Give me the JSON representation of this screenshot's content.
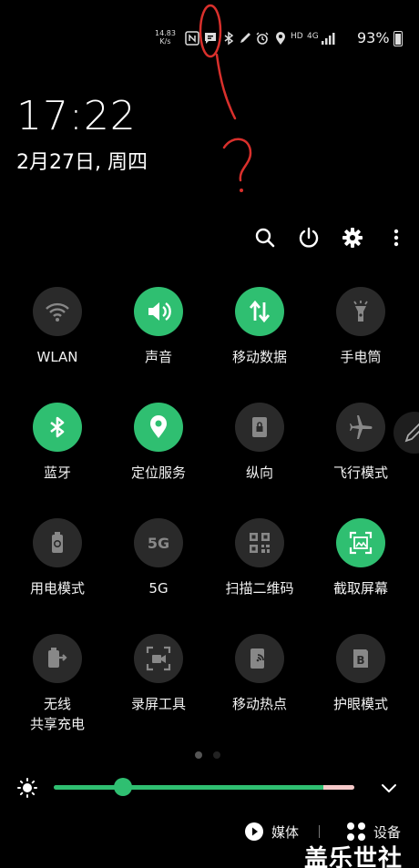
{
  "status_bar": {
    "speed_value": "14.83",
    "speed_unit": "K/s",
    "network": "HD",
    "signal": "4G",
    "battery_percent": "93%",
    "icons": [
      "nfc-icon",
      "message-icon",
      "bluetooth-icon",
      "pen-icon",
      "alarm-icon",
      "location-icon",
      "hd-icon",
      "signal-icon",
      "battery-icon"
    ]
  },
  "clock": {
    "time": "17:22",
    "date": "2月27日, 周四"
  },
  "toolbar": {
    "icons": [
      "search-icon",
      "power-icon",
      "settings-icon",
      "more-icon"
    ]
  },
  "tiles": [
    {
      "label": "WLAN",
      "icon": "wifi-icon",
      "active": false
    },
    {
      "label": "声音",
      "icon": "volume-icon",
      "active": true
    },
    {
      "label": "移动数据",
      "icon": "mobile-data-icon",
      "active": true
    },
    {
      "label": "手电筒",
      "icon": "flashlight-icon",
      "active": false
    },
    {
      "label": "蓝牙",
      "icon": "bluetooth-icon",
      "active": true
    },
    {
      "label": "定位服务",
      "icon": "location-icon",
      "active": true
    },
    {
      "label": "纵向",
      "icon": "portrait-lock-icon",
      "active": false
    },
    {
      "label": "飞行模式",
      "icon": "airplane-icon",
      "active": false
    },
    {
      "label": "用电模式",
      "icon": "power-mode-icon",
      "active": false
    },
    {
      "label": "5G",
      "icon": "5g-icon",
      "active": false
    },
    {
      "label": "扫描二维码",
      "icon": "qr-code-icon",
      "active": false
    },
    {
      "label": "截取屏幕",
      "icon": "screenshot-icon",
      "active": true
    },
    {
      "label": "无线\n共享充电",
      "icon": "wireless-share-icon",
      "active": false
    },
    {
      "label": "录屏工具",
      "icon": "screen-record-icon",
      "active": false
    },
    {
      "label": "移动热点",
      "icon": "hotspot-icon",
      "active": false
    },
    {
      "label": "护眼模式",
      "icon": "eye-comfort-icon",
      "active": false
    }
  ],
  "pager": {
    "pages": 2,
    "current": 1
  },
  "brightness": {
    "level": 0.23
  },
  "bottom": {
    "media_label": "媒体",
    "devices_label": "设备"
  },
  "colors": {
    "accent": "#2fbf71",
    "tile_off": "#2a2a2a",
    "annotation": "#d9302c"
  },
  "watermark": "盖乐世社区"
}
